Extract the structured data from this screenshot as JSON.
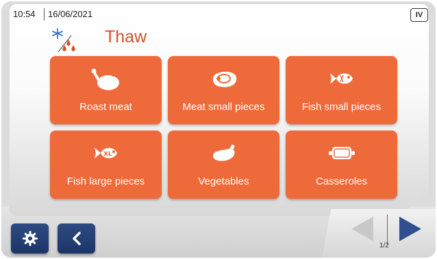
{
  "status": {
    "time": "10:54",
    "date": "16/06/2021",
    "badge": "IV"
  },
  "page": {
    "title": "Thaw",
    "icon": "thaw-icon"
  },
  "programs": [
    {
      "label": "Roast meat",
      "icon": "roast-chicken-icon"
    },
    {
      "label": "Meat small pieces",
      "icon": "steak-icon"
    },
    {
      "label": "Fish small pieces",
      "icon": "fish-small-icon"
    },
    {
      "label": "Fish large pieces",
      "icon": "fish-xl-icon"
    },
    {
      "label": "Vegetables",
      "icon": "eggplant-icon"
    },
    {
      "label": "Casseroles",
      "icon": "casserole-icon"
    }
  ],
  "footer": {
    "settings_icon": "gear-icon",
    "back_icon": "back-arrow-icon",
    "page_indicator": "1/2"
  },
  "colors": {
    "tile": "#ef6a3a",
    "title": "#d2512a",
    "button": "#1f3a6e",
    "arrow_active": "#2f4f8f",
    "arrow_inactive": "#c8c8c8"
  }
}
